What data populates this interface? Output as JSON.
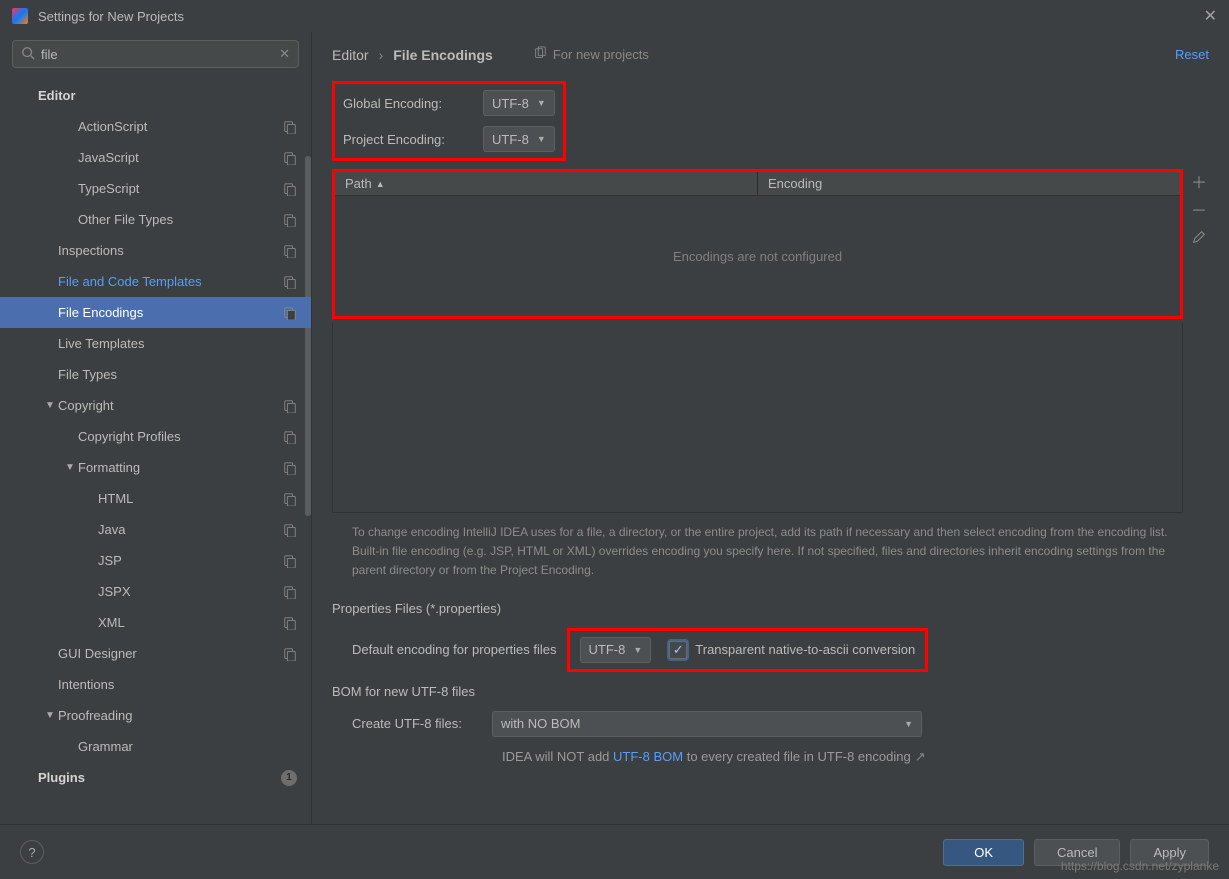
{
  "window": {
    "title": "Settings for New Projects"
  },
  "search": {
    "value": "file"
  },
  "sidebar": {
    "items": [
      {
        "label": "Editor",
        "level": 0,
        "bold": true
      },
      {
        "label": "ActionScript",
        "level": 2,
        "override": true
      },
      {
        "label": "JavaScript",
        "level": 2,
        "override": true
      },
      {
        "label": "TypeScript",
        "level": 2,
        "override": true
      },
      {
        "label": "Other File Types",
        "level": 2,
        "override": true
      },
      {
        "label": "Inspections",
        "level": 1,
        "override": true
      },
      {
        "label": "File and Code Templates",
        "level": 1,
        "override": true,
        "highlighted": true
      },
      {
        "label": "File Encodings",
        "level": 1,
        "override": true,
        "selected": true
      },
      {
        "label": "Live Templates",
        "level": 1
      },
      {
        "label": "File Types",
        "level": 1
      },
      {
        "label": "Copyright",
        "level": 1,
        "override": true,
        "caret": true
      },
      {
        "label": "Copyright Profiles",
        "level": 2,
        "override": true
      },
      {
        "label": "Formatting",
        "level": 2,
        "override": true,
        "caret": true
      },
      {
        "label": "HTML",
        "level": 3,
        "override": true
      },
      {
        "label": "Java",
        "level": 3,
        "override": true
      },
      {
        "label": "JSP",
        "level": 3,
        "override": true
      },
      {
        "label": "JSPX",
        "level": 3,
        "override": true
      },
      {
        "label": "XML",
        "level": 3,
        "override": true
      },
      {
        "label": "GUI Designer",
        "level": 1,
        "override": true
      },
      {
        "label": "Intentions",
        "level": 1
      },
      {
        "label": "Proofreading",
        "level": 1,
        "caret": true
      },
      {
        "label": "Grammar",
        "level": 2
      },
      {
        "label": "Plugins",
        "level": 0,
        "bold": true,
        "badge": "1"
      }
    ]
  },
  "breadcrumb": {
    "parent": "Editor",
    "current": "File Encodings",
    "for_new": "For new projects",
    "reset": "Reset"
  },
  "encoding": {
    "global_label": "Global Encoding:",
    "global_value": "UTF-8",
    "project_label": "Project Encoding:",
    "project_value": "UTF-8"
  },
  "table": {
    "col_path": "Path",
    "col_encoding": "Encoding",
    "empty": "Encodings are not configured"
  },
  "help_text": "To change encoding IntelliJ IDEA uses for a file, a directory, or the entire project, add its path if necessary and then select encoding from the encoding list. Built-in file encoding (e.g. JSP, HTML or XML) overrides encoding you specify here. If not specified, files and directories inherit encoding settings from the parent directory or from the Project Encoding.",
  "properties": {
    "heading": "Properties Files (*.properties)",
    "default_label": "Default encoding for properties files",
    "default_value": "UTF-8",
    "checkbox_label": "Transparent native-to-ascii conversion",
    "checkbox_checked": true
  },
  "bom": {
    "heading": "BOM for new UTF-8 files",
    "create_label": "Create UTF-8 files:",
    "create_value": "with NO BOM",
    "note_before": "IDEA will NOT add ",
    "note_link": "UTF-8 BOM",
    "note_after": " to every created file in UTF-8 encoding"
  },
  "footer": {
    "ok": "OK",
    "cancel": "Cancel",
    "apply": "Apply"
  },
  "watermark": "https://blog.csdn.net/zyplanke"
}
